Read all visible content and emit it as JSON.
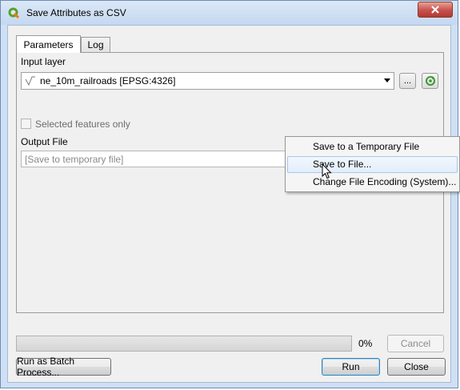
{
  "window": {
    "title": "Save Attributes as CSV",
    "icon": "qgis-icon"
  },
  "tabs": [
    {
      "label": "Parameters",
      "active": true
    },
    {
      "label": "Log",
      "active": false
    }
  ],
  "params": {
    "input_layer_label": "Input layer",
    "input_layer_value": "ne_10m_railroads [EPSG:4326]",
    "browse_label": "...",
    "selected_only_label": "Selected features only",
    "selected_only_checked": false,
    "output_file_label": "Output File",
    "output_file_placeholder": "[Save to temporary file]"
  },
  "context_menu": {
    "items": [
      {
        "label": "Save to a Temporary File",
        "hovered": false
      },
      {
        "label": "Save to File...",
        "hovered": true
      },
      {
        "label": "Change File Encoding (System)...",
        "hovered": false
      }
    ]
  },
  "progress": {
    "value_percent": 0,
    "label": "0%"
  },
  "buttons": {
    "cancel": "Cancel",
    "batch": "Run as Batch Process...",
    "run": "Run",
    "close": "Close"
  },
  "colors": {
    "titlebar": "#c4d8f0",
    "menu_hover": "#e2eefb",
    "close_button": "#c75050"
  }
}
